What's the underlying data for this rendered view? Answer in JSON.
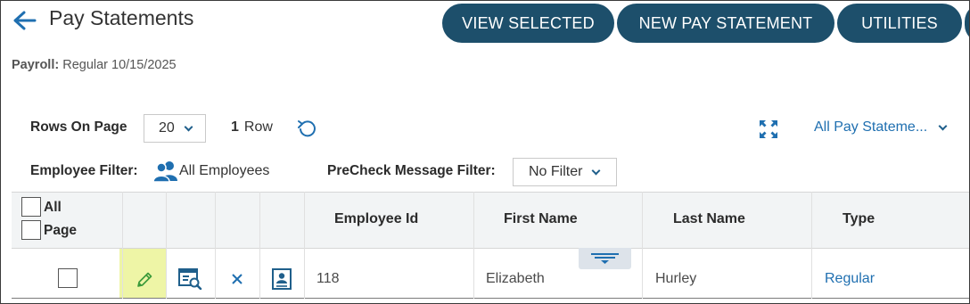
{
  "header": {
    "title": "Pay Statements",
    "back_icon": "back-arrow-icon",
    "buttons": {
      "view_selected": "VIEW SELECTED",
      "new_pay_statement": "NEW PAY STATEMENT",
      "utilities": "UTILITIES"
    }
  },
  "payroll": {
    "label": "Payroll:",
    "value": "Regular 10/15/2025"
  },
  "toolbar": {
    "rows_on_page_label": "Rows On Page",
    "rows_on_page_value": "20",
    "row_count_number": "1",
    "row_count_label": "Row",
    "view_filter_value": "All Pay Stateme...",
    "employee_filter_label": "Employee Filter:",
    "employee_filter_value": "All Employees",
    "precheck_filter_label": "PreCheck Message Filter:",
    "precheck_filter_value": "No Filter"
  },
  "grid": {
    "select_all_label": "All",
    "select_page_label": "Page",
    "columns": [
      "Employee Id",
      "First Name",
      "Last Name",
      "Type"
    ],
    "rows": [
      {
        "employee_id": "118",
        "first_name": "Elizabeth",
        "last_name": "Hurley",
        "type": "Regular"
      }
    ]
  },
  "colors": {
    "primary_button": "#1d4f6b",
    "accent_blue": "#1f6fb0",
    "edit_highlight": "#eef5a6",
    "header_bg": "#f2f4f5"
  }
}
